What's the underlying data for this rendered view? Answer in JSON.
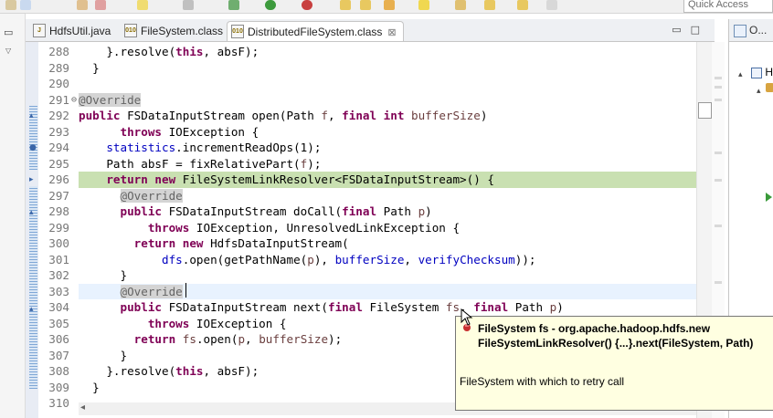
{
  "toolbar": {
    "quick_access_placeholder": "Quick Access"
  },
  "tabs": [
    {
      "label": "HdfsUtil.java",
      "icon": "java-file-icon",
      "active": false
    },
    {
      "label": "FileSystem.class",
      "icon": "class-file-icon",
      "active": false
    },
    {
      "label": "DistributedFileSystem.class",
      "icon": "class-file-icon",
      "active": true,
      "close": "⊠"
    }
  ],
  "outline": {
    "tab_label": "O...",
    "tree": [
      "H",
      ""
    ]
  },
  "code_lines": [
    {
      "num": "288",
      "tokens": [
        [
          "p",
          "    }.resolve("
        ],
        [
          "kw",
          "this"
        ],
        [
          "p",
          ", absF);"
        ]
      ]
    },
    {
      "num": "289",
      "tokens": [
        [
          "p",
          "  }"
        ]
      ]
    },
    {
      "num": "290",
      "tokens": []
    },
    {
      "num": "291",
      "fold": "⊖",
      "tokens": [
        [
          "an",
          "@Override"
        ]
      ]
    },
    {
      "num": "292",
      "tokens": [
        [
          "kw",
          "public"
        ],
        [
          "p",
          " FSDataInputStream open(Path "
        ],
        [
          "var",
          "f"
        ],
        [
          "p",
          ", "
        ],
        [
          "kw",
          "final int"
        ],
        [
          "p",
          " "
        ],
        [
          "var",
          "bufferSize"
        ],
        [
          "p",
          ")"
        ]
      ]
    },
    {
      "num": "293",
      "tokens": [
        [
          "p",
          "      "
        ],
        [
          "kw",
          "throws"
        ],
        [
          "p",
          " IOException {"
        ]
      ]
    },
    {
      "num": "294",
      "tokens": [
        [
          "p",
          "    "
        ],
        [
          "fld",
          "statistics"
        ],
        [
          "p",
          ".incrementReadOps(1);"
        ]
      ]
    },
    {
      "num": "295",
      "tokens": [
        [
          "p",
          "    Path absF = fixRelativePart("
        ],
        [
          "var",
          "f"
        ],
        [
          "p",
          ");"
        ]
      ]
    },
    {
      "num": "296",
      "hl": "green",
      "tokens": [
        [
          "p",
          "    "
        ],
        [
          "kw",
          "return new"
        ],
        [
          "p",
          " FileSystemLinkResolver<FSDataInputStream>() {"
        ]
      ]
    },
    {
      "num": "297",
      "tokens": [
        [
          "p",
          "      "
        ],
        [
          "an",
          "@Override"
        ]
      ]
    },
    {
      "num": "298",
      "tokens": [
        [
          "p",
          "      "
        ],
        [
          "kw",
          "public"
        ],
        [
          "p",
          " FSDataInputStream doCall("
        ],
        [
          "kw",
          "final"
        ],
        [
          "p",
          " Path "
        ],
        [
          "var",
          "p"
        ],
        [
          "p",
          ")"
        ]
      ]
    },
    {
      "num": "299",
      "tokens": [
        [
          "p",
          "          "
        ],
        [
          "kw",
          "throws"
        ],
        [
          "p",
          " IOException, UnresolvedLinkException {"
        ]
      ]
    },
    {
      "num": "300",
      "tokens": [
        [
          "p",
          "        "
        ],
        [
          "kw",
          "return new"
        ],
        [
          "p",
          " HdfsDataInputStream("
        ]
      ]
    },
    {
      "num": "301",
      "tokens": [
        [
          "p",
          "            "
        ],
        [
          "fld",
          "dfs"
        ],
        [
          "p",
          ".open(getPathName("
        ],
        [
          "var",
          "p"
        ],
        [
          "p",
          "), "
        ],
        [
          "fld",
          "bufferSize"
        ],
        [
          "p",
          ", "
        ],
        [
          "fld",
          "verifyChecksum"
        ],
        [
          "p",
          "));"
        ]
      ]
    },
    {
      "num": "302",
      "tokens": [
        [
          "p",
          "      }"
        ]
      ]
    },
    {
      "num": "303",
      "hl": "cur",
      "tokens": [
        [
          "p",
          "      "
        ],
        [
          "an",
          "@Override"
        ]
      ]
    },
    {
      "num": "304",
      "tokens": [
        [
          "p",
          "      "
        ],
        [
          "kw",
          "public"
        ],
        [
          "p",
          " FSDataInputStream next("
        ],
        [
          "kw",
          "final"
        ],
        [
          "p",
          " FileSystem "
        ],
        [
          "var",
          "fs"
        ],
        [
          "p",
          ", "
        ],
        [
          "kw",
          "final"
        ],
        [
          "p",
          " Path "
        ],
        [
          "var",
          "p"
        ],
        [
          "p",
          ")"
        ]
      ]
    },
    {
      "num": "305",
      "tokens": [
        [
          "p",
          "          "
        ],
        [
          "kw",
          "throws"
        ],
        [
          "p",
          " IOException {"
        ]
      ]
    },
    {
      "num": "306",
      "tokens": [
        [
          "p",
          "        "
        ],
        [
          "kw",
          "return"
        ],
        [
          "p",
          " "
        ],
        [
          "var",
          "fs"
        ],
        [
          "p",
          ".open("
        ],
        [
          "var",
          "p"
        ],
        [
          "p",
          ", "
        ],
        [
          "var",
          "bufferSize"
        ],
        [
          "p",
          ");"
        ]
      ]
    },
    {
      "num": "307",
      "tokens": [
        [
          "p",
          "      }"
        ]
      ]
    },
    {
      "num": "308",
      "tokens": [
        [
          "p",
          "    }.resolve("
        ],
        [
          "kw",
          "this"
        ],
        [
          "p",
          ", absF);"
        ]
      ]
    },
    {
      "num": "309",
      "tokens": [
        [
          "p",
          "  }"
        ]
      ]
    },
    {
      "num": "310",
      "tokens": []
    }
  ],
  "tooltip": {
    "title": "FileSystem fs - org.apache.hadoop.hdfs.new FileSystemLinkResolver() {...}.next(FileSystem, Path)",
    "description": "FileSystem with which to retry call"
  },
  "colors": {
    "keyword": "#7f0055",
    "annotation": "#646464",
    "field": "#0000c0",
    "variable": "#6a3e3e",
    "line_highlight_green": "#c9e0b1",
    "current_line": "#e8f2fe",
    "tooltip_bg": "#ffffe1"
  }
}
